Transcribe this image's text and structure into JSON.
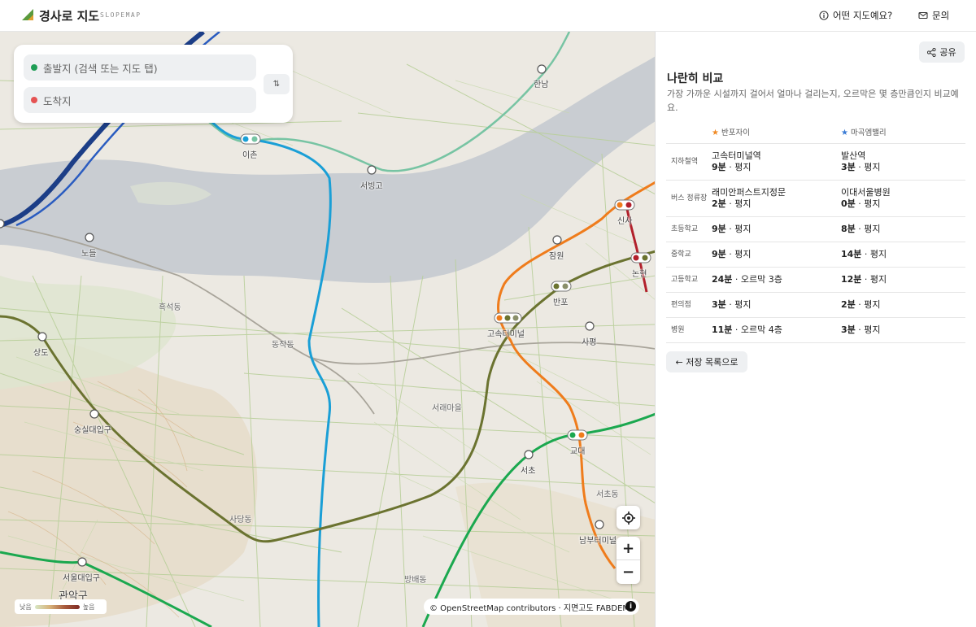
{
  "header": {
    "brand": "경사로 지도",
    "brand_sub": "SLOPEMAP",
    "about_label": "어떤 지도예요?",
    "contact_label": "문의"
  },
  "search": {
    "origin_placeholder": "출발지 (검색 또는 지도 탭)",
    "destination_placeholder": "도착지",
    "swap_label": "⇅",
    "origin_color": "#1f9d55",
    "destination_color": "#e55353"
  },
  "map": {
    "labels": [
      "한남",
      "이촌",
      "서빙고",
      "노들",
      "흑석동",
      "동작동",
      "잠원",
      "반포",
      "신사",
      "논현",
      "고속터미널",
      "사평",
      "상도",
      "숭실대입구",
      "서래마을",
      "교대",
      "서초",
      "서초동",
      "사당동",
      "남부터미널",
      "서울대입구",
      "관악구",
      "방배동"
    ],
    "legend_low": "낮음",
    "legend_high": "높음",
    "attribution": "© OpenStreetMap contributors · 지면고도 FABDEM",
    "zoom_in": "+",
    "zoom_out": "−",
    "line_colors": {
      "line9": "#8a8f2e",
      "line4": "#1a9fd6",
      "line3": "#ef7c1c",
      "line2": "#1ba84f",
      "line7": "#6b7330",
      "gyeongui": "#77c4a3",
      "shinbundang": "#b2202b"
    }
  },
  "panel": {
    "share_label": "공유",
    "title": "나란히 비교",
    "description": "가장 가까운 시설까지 걸어서 얼마나 걸리는지, 오르막은 몇 층만큼인지 비교예요.",
    "place_a": "반포자이",
    "place_b": "마곡엠밸리",
    "star_color_a": "#f08a24",
    "star_color_b": "#3a7bd5",
    "back_label": "← 저장 목록으로",
    "rows": [
      {
        "category": "지하철역",
        "a_name": "고속터미널역",
        "a_time": "9분",
        "a_slope": " · 평지",
        "b_name": "발산역",
        "b_time": "3분",
        "b_slope": " · 평지"
      },
      {
        "category": "버스 정류장",
        "a_name": "래미안퍼스트지정문",
        "a_time": "2분",
        "a_slope": " · 평지",
        "b_name": "이대서울병원",
        "b_time": "0분",
        "b_slope": " · 평지"
      },
      {
        "category": "초등학교",
        "a_name": "",
        "a_time": "9분",
        "a_slope": " · 평지",
        "b_name": "",
        "b_time": "8분",
        "b_slope": " · 평지"
      },
      {
        "category": "중학교",
        "a_name": "",
        "a_time": "9분",
        "a_slope": " · 평지",
        "b_name": "",
        "b_time": "14분",
        "b_slope": " · 평지"
      },
      {
        "category": "고등학교",
        "a_name": "",
        "a_time": "24분",
        "a_slope": " · 오르막 3층",
        "b_name": "",
        "b_time": "12분",
        "b_slope": " · 평지"
      },
      {
        "category": "편의점",
        "a_name": "",
        "a_time": "3분",
        "a_slope": " · 평지",
        "b_name": "",
        "b_time": "2분",
        "b_slope": " · 평지"
      },
      {
        "category": "병원",
        "a_name": "",
        "a_time": "11분",
        "a_slope": " · 오르막 4층",
        "b_name": "",
        "b_time": "3분",
        "b_slope": " · 평지"
      }
    ]
  }
}
